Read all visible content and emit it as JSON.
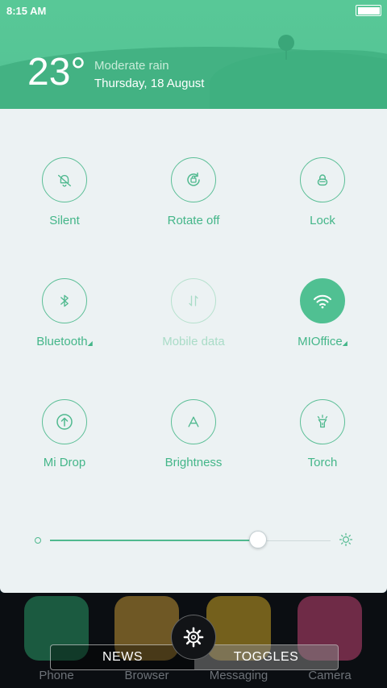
{
  "status_bar": {
    "time": "8:15 AM"
  },
  "weather": {
    "temperature": "23°",
    "condition": "Moderate rain",
    "date": "Thursday, 18 August"
  },
  "toggles": [
    {
      "label": "Silent",
      "icon": "bell-off-icon",
      "state": "off"
    },
    {
      "label": "Rotate off",
      "icon": "rotate-lock-icon",
      "state": "off"
    },
    {
      "label": "Lock",
      "icon": "lock-icon",
      "state": "off"
    },
    {
      "label": "Bluetooth",
      "icon": "bluetooth-icon",
      "state": "off",
      "has_menu": true
    },
    {
      "label": "Mobile data",
      "icon": "mobile-data-icon",
      "state": "disabled"
    },
    {
      "label": "MIOffice",
      "icon": "wifi-icon",
      "state": "on",
      "has_menu": true
    },
    {
      "label": "Mi Drop",
      "icon": "upload-icon",
      "state": "off"
    },
    {
      "label": "Brightness",
      "icon": "auto-brightness-icon",
      "state": "off"
    },
    {
      "label": "Torch",
      "icon": "torch-icon",
      "state": "off"
    }
  ],
  "brightness": {
    "level": 0.74
  },
  "dock_apps": [
    {
      "label": "Phone",
      "color": "#2fb87a"
    },
    {
      "label": "Browser",
      "color": "#e9b43d"
    },
    {
      "label": "Messaging",
      "color": "#f3c52a"
    },
    {
      "label": "Camera",
      "color": "#e8508a"
    }
  ],
  "tabs": [
    {
      "label": "NEWS",
      "active": false
    },
    {
      "label": "TOGGLES",
      "active": true
    }
  ],
  "colors": {
    "accent": "#50c092",
    "header": "#56c596",
    "panel_bg": "#ecf2f3"
  }
}
